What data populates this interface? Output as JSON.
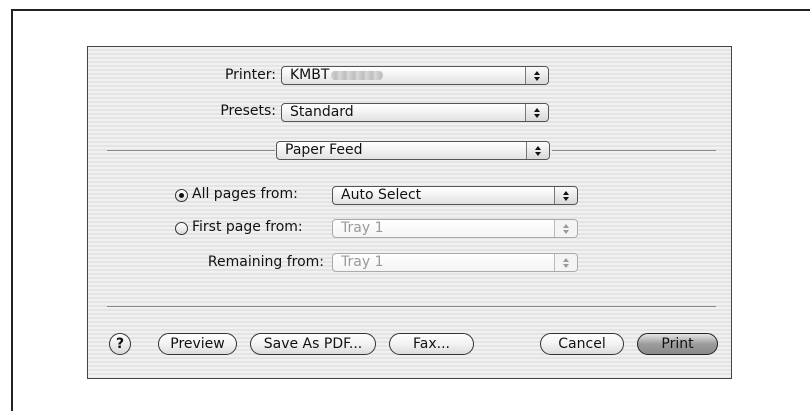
{
  "printer": {
    "label": "Printer:",
    "value": "KMBT"
  },
  "presets": {
    "label": "Presets:",
    "value": "Standard"
  },
  "panel": {
    "value": "Paper Feed"
  },
  "paper_feed": {
    "all_pages": {
      "label": "All pages from:",
      "selected": true,
      "value": "Auto Select"
    },
    "first_page": {
      "label": "First page from:",
      "selected": false,
      "value": "Tray 1"
    },
    "remaining": {
      "label": "Remaining from:",
      "value": "Tray 1"
    }
  },
  "buttons": {
    "help": "?",
    "preview": "Preview",
    "save_pdf": "Save As PDF...",
    "fax": "Fax...",
    "cancel": "Cancel",
    "print": "Print"
  },
  "icons": {
    "help": "help-icon",
    "popup_arrows": "up-down-arrows-icon",
    "radio_on": "radio-selected-icon",
    "radio_off": "radio-unselected-icon"
  }
}
